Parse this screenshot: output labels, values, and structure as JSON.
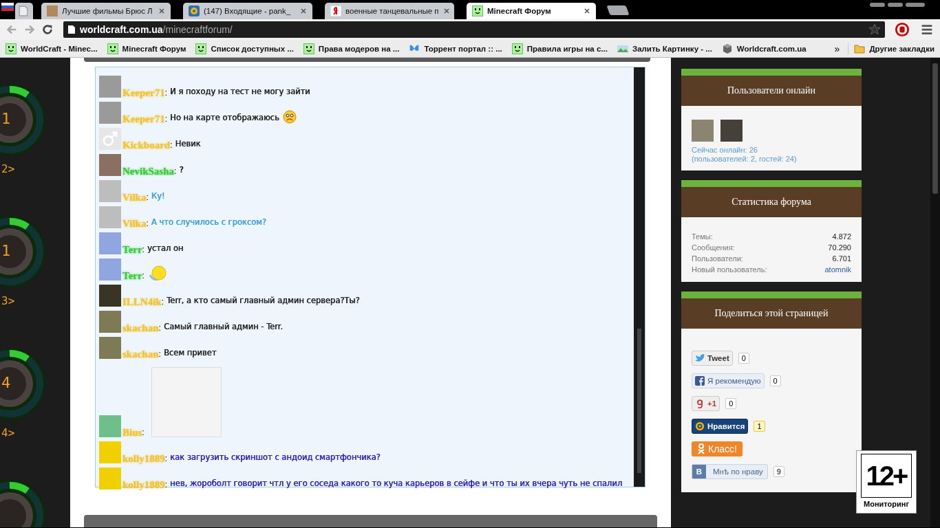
{
  "browser": {
    "tabs": [
      {
        "selected": false
      },
      {
        "title": "Лучшие фильмы Брюс Л",
        "selected": false
      },
      {
        "title": "(147) Входящие - pank_",
        "selected": false
      },
      {
        "title": "военные танцевальные п",
        "selected": false
      },
      {
        "title": "Minecraft Форум",
        "selected": true
      }
    ],
    "address": {
      "host": "worldcraft.com.ua",
      "path": "/minecraftforum/"
    },
    "bookmarks": [
      "WorldCraft - Minec...",
      "Minecraft Форум",
      "Список доступных ...",
      "Права модеров на ...",
      "Торрент портал :: ...",
      "Правила игры на с...",
      "Залить Картинку - ...",
      "Worldcraft.com.ua"
    ],
    "more": "»",
    "other_bookmarks": "Другие закладки"
  },
  "servers": [
    {
      "number": "1",
      "label": "2>"
    },
    {
      "number": "1",
      "label": "3>"
    },
    {
      "number": "4",
      "label": "4>"
    }
  ],
  "chat": {
    "messages": [
      {
        "user": {
          "name": "Keeper71",
          "color": "#f2c230"
        },
        "separator": ":",
        "message": {
          "text": "И я походу на тест не могу зайти",
          "color": "#222222"
        },
        "kind": "text"
      },
      {
        "user": {
          "name": "Keeper71",
          "color": "#f2c230"
        },
        "separator": ":",
        "message": {
          "text": "Но на карте отображаюсь",
          "color": "#222222"
        },
        "kind": "sad"
      },
      {
        "user": {
          "name": "Kickboard",
          "color": "#f2c230"
        },
        "separator": ":",
        "message": {
          "text": "Невик",
          "color": "#222222"
        },
        "kind": "text"
      },
      {
        "user": {
          "name": "NevikSasha",
          "color": "#33cc33"
        },
        "separator": ":",
        "message": {
          "text": "?",
          "color": "#000000"
        },
        "kind": "text"
      },
      {
        "user": {
          "name": "Vilka",
          "color": "#f2c230"
        },
        "separator": ":",
        "message": {
          "text": "Ку!",
          "color": "#3a9ed8"
        },
        "kind": "text"
      },
      {
        "user": {
          "name": "Vilka",
          "color": "#f2c230"
        },
        "separator": ":",
        "message": {
          "text": "А что случилось с гроксом?",
          "color": "#3a9ed8"
        },
        "kind": "text"
      },
      {
        "user": {
          "name": "Terr",
          "color": "#33cc33"
        },
        "separator": ":",
        "message": {
          "text": "устал он",
          "color": "#222222"
        },
        "kind": "text"
      },
      {
        "user": {
          "name": "Terr",
          "color": "#33cc33"
        },
        "separator": ":",
        "kind": "ball"
      },
      {
        "user": {
          "name": "ILLN4ik",
          "color": "#f2c230"
        },
        "separator": ":",
        "message": {
          "text": "Terr, а кто самый главный админ сервера?Ты?",
          "color": "#222222"
        },
        "kind": "text"
      },
      {
        "user": {
          "name": "skachan",
          "color": "#f2c230"
        },
        "separator": ":",
        "message": {
          "text": "Самый главный админ - Terr.",
          "color": "#222222"
        },
        "kind": "text"
      },
      {
        "user": {
          "name": "skachan",
          "color": "#f2c230"
        },
        "separator": ":",
        "message": {
          "text": "Всем привет",
          "color": "#222222"
        },
        "kind": "text"
      },
      {
        "user": {
          "name": "Bius",
          "color": "#f2c230"
        },
        "separator": ":",
        "kind": "picture"
      },
      {
        "user": {
          "name": "kolly1889",
          "color": "#f2c230"
        },
        "separator": ":",
        "message": {
          "text": "как загрузить скриншот с андоид смартфончика?",
          "color": "#3322bb"
        },
        "kind": "text"
      },
      {
        "user": {
          "name": "kolly1889",
          "color": "#f2c230"
        },
        "separator": ":",
        "message": {
          "text": "нев, жороболт говорит чтл у его соседа какого то куча карьеров в сейфе и что ты их вчера чуть не спалил",
          "color": "#3322bb"
        },
        "kind": "text"
      }
    ]
  },
  "sidebar": {
    "online": {
      "title": "Пользователи онлайн",
      "count": "Сейчас онлайн: 26",
      "detail": "(пользователей: 2, гостей: 24)"
    },
    "stats": {
      "title": "Статистика форума",
      "rows": [
        {
          "label": "Темы:",
          "value": "4.872",
          "kind": "number"
        },
        {
          "label": "Сообщения:",
          "value": "70.290",
          "kind": "number"
        },
        {
          "label": "Пользователи:",
          "value": "6.701",
          "kind": "number"
        },
        {
          "label": "Новый пользователь:",
          "value": "atomnik",
          "kind": "link"
        }
      ]
    },
    "share": {
      "title": "Поделиться этой страницей",
      "buttons": [
        {
          "kind": "twitter",
          "label": "Tweet",
          "count": "0"
        },
        {
          "kind": "facebook",
          "label": "Я рекомендую",
          "count": "0"
        },
        {
          "kind": "google",
          "label": "+1",
          "count": "0"
        },
        {
          "kind": "mail",
          "label": "Нравится",
          "count": "1"
        },
        {
          "kind": "ok",
          "label": "Класс!"
        },
        {
          "kind": "vk",
          "label": "Мнѣ по нраву",
          "badge": "В",
          "count": "9"
        }
      ]
    }
  },
  "rating": {
    "age": "12+",
    "caption": "Мониторинг"
  }
}
